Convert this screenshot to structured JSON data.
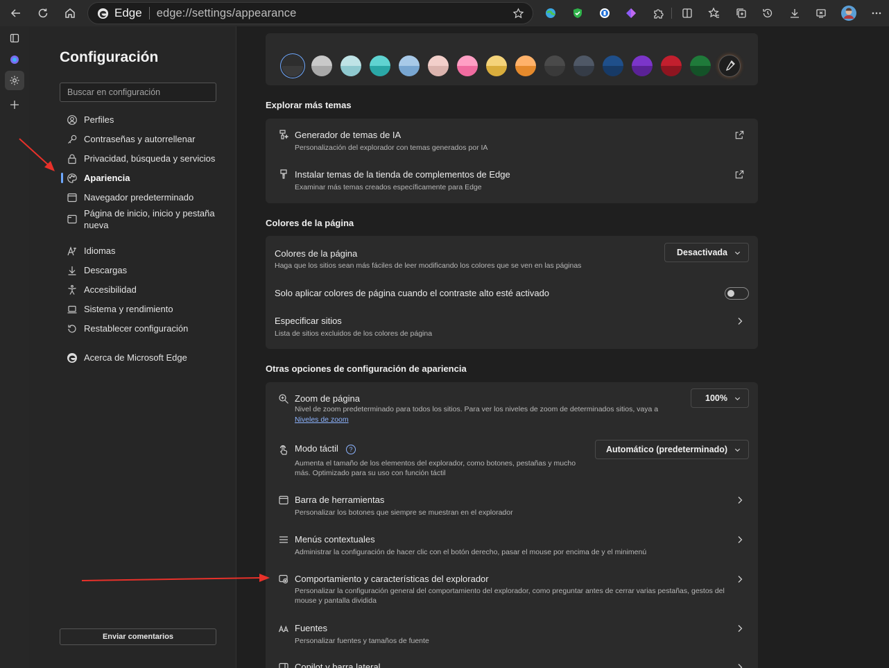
{
  "browser": {
    "brand": "Edge",
    "url": "edge://settings/appearance"
  },
  "sidebar": {
    "title": "Configuración",
    "search_placeholder": "Buscar en configuración",
    "items": [
      {
        "label": "Perfiles",
        "icon": "profile-icon"
      },
      {
        "label": "Contraseñas y autorrellenar",
        "icon": "key-icon"
      },
      {
        "label": "Privacidad, búsqueda y servicios",
        "icon": "lock-icon"
      },
      {
        "label": "Apariencia",
        "icon": "palette-icon",
        "active": true
      },
      {
        "label": "Navegador predeterminado",
        "icon": "browser-icon"
      },
      {
        "label": "Página de inicio, inicio y pestaña nueva",
        "icon": "home-tab-icon"
      },
      {
        "label": "Idiomas",
        "icon": "language-icon"
      },
      {
        "label": "Descargas",
        "icon": "download-icon"
      },
      {
        "label": "Accesibilidad",
        "icon": "accessibility-icon"
      },
      {
        "label": "Sistema y rendimiento",
        "icon": "laptop-icon"
      },
      {
        "label": "Restablecer configuración",
        "icon": "reset-icon"
      },
      {
        "label": "Acerca de Microsoft Edge",
        "icon": "edge-logo-icon"
      }
    ],
    "feedback_label": "Enviar comentarios"
  },
  "themes": {
    "swatches": [
      {
        "top": "#2e2e2e",
        "bottom": "#3a3a3a"
      },
      {
        "top": "#c9c9c9",
        "bottom": "#a9a9a9"
      },
      {
        "top": "#bfe3e6",
        "bottom": "#8fc9cf"
      },
      {
        "top": "#5fd3d1",
        "bottom": "#2aa7a6"
      },
      {
        "top": "#a7c9e8",
        "bottom": "#78a6d1"
      },
      {
        "top": "#f2cfca",
        "bottom": "#dbb4ae"
      },
      {
        "top": "#ff9fc4",
        "bottom": "#f06ca0"
      },
      {
        "top": "#f4d37a",
        "bottom": "#d9ad3c"
      },
      {
        "top": "#ffb26a",
        "bottom": "#e58a2c"
      },
      {
        "top": "#4a4a4a",
        "bottom": "#3a3a3a"
      },
      {
        "top": "#4f5866",
        "bottom": "#353c47"
      },
      {
        "top": "#1f4f8a",
        "bottom": "#173a66"
      },
      {
        "top": "#7b35c9",
        "bottom": "#5a2296"
      },
      {
        "top": "#c21f2e",
        "bottom": "#8e1520"
      },
      {
        "top": "#1f7a3a",
        "bottom": "#145228"
      }
    ]
  },
  "explore": {
    "heading": "Explorar más temas",
    "rows": [
      {
        "title": "Generador de temas de IA",
        "desc": "Personalización del explorador con temas generados por IA"
      },
      {
        "title": "Instalar temas de la tienda de complementos de Edge",
        "desc": "Examinar más temas creados específicamente para Edge"
      }
    ]
  },
  "page_colors": {
    "heading": "Colores de la página",
    "row1_title": "Colores de la página",
    "row1_desc": "Haga que los sitios sean más fáciles de leer modificando los colores que se ven en las páginas",
    "row1_value": "Desactivada",
    "row2_title": "Solo aplicar colores de página cuando el contraste alto esté activado",
    "row2_on": false,
    "row3_title": "Especificar sitios",
    "row3_desc": "Lista de sitios excluidos de los colores de página"
  },
  "other": {
    "heading": "Otras opciones de configuración de apariencia",
    "zoom_title": "Zoom de página",
    "zoom_desc": "Nivel de zoom predeterminado para todos los sitios. Para ver los niveles de zoom de determinados sitios, vaya a",
    "zoom_link": "Niveles de zoom",
    "zoom_value": "100%",
    "touch_title": "Modo táctil",
    "touch_help": "?",
    "touch_desc_1": "Aumenta el tamaño de los elementos del explorador, como botones, pestañas y mucho",
    "touch_desc_2": "más. Optimizado para su uso con función táctil",
    "touch_value": "Automático (predeterminado)",
    "toolbar_title": "Barra de herramientas",
    "toolbar_desc": "Personalizar los botones que siempre se muestran en el explorador",
    "menus_title": "Menús contextuales",
    "menus_desc": "Administrar la configuración de hacer clic con el botón derecho, pasar el mouse por encima de y el minimenú",
    "behavior_title": "Comportamiento y características del explorador",
    "behavior_desc_1": "Personalizar la configuración general del comportamiento del explorador, como preguntar antes de cerrar varias pestañas, gestos del",
    "behavior_desc_2": "mouse y pantalla dividida",
    "fonts_title": "Fuentes",
    "fonts_desc": "Personalizar fuentes y tamaños de fuente",
    "copilot_title": "Copilot y barra lateral"
  },
  "annotation_color": "#e8312a"
}
